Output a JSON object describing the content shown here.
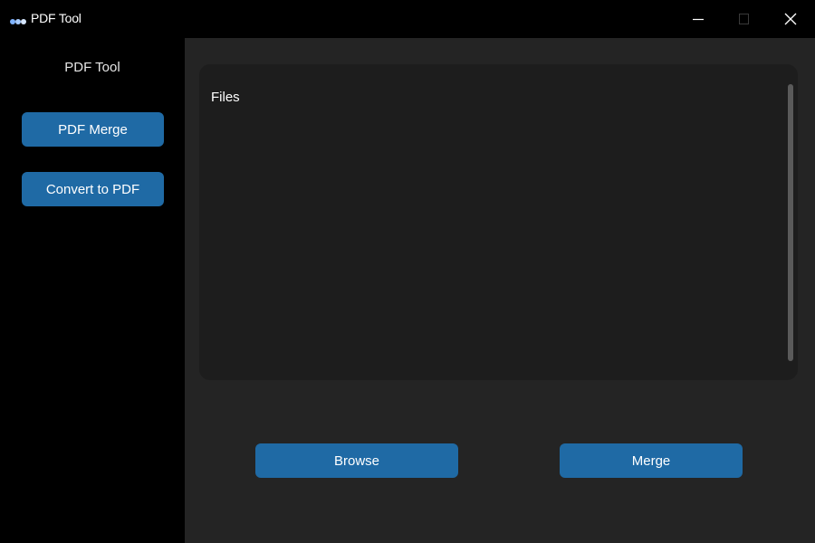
{
  "window": {
    "title": "PDF Tool",
    "app_icon": "app-dots-icon",
    "controls": {
      "minimize": "minimize-icon",
      "maximize": "maximize-icon",
      "close": "close-icon"
    }
  },
  "sidebar": {
    "title": "PDF Tool",
    "buttons": [
      {
        "label": "PDF Merge"
      },
      {
        "label": "Convert to PDF"
      }
    ]
  },
  "main": {
    "files_label": "Files",
    "browse_label": "Browse",
    "merge_label": "Merge"
  },
  "colors": {
    "accent": "#1f6aa5",
    "sidebar_bg": "#000000",
    "main_bg": "#242424",
    "panel_bg": "#1d1d1d"
  }
}
